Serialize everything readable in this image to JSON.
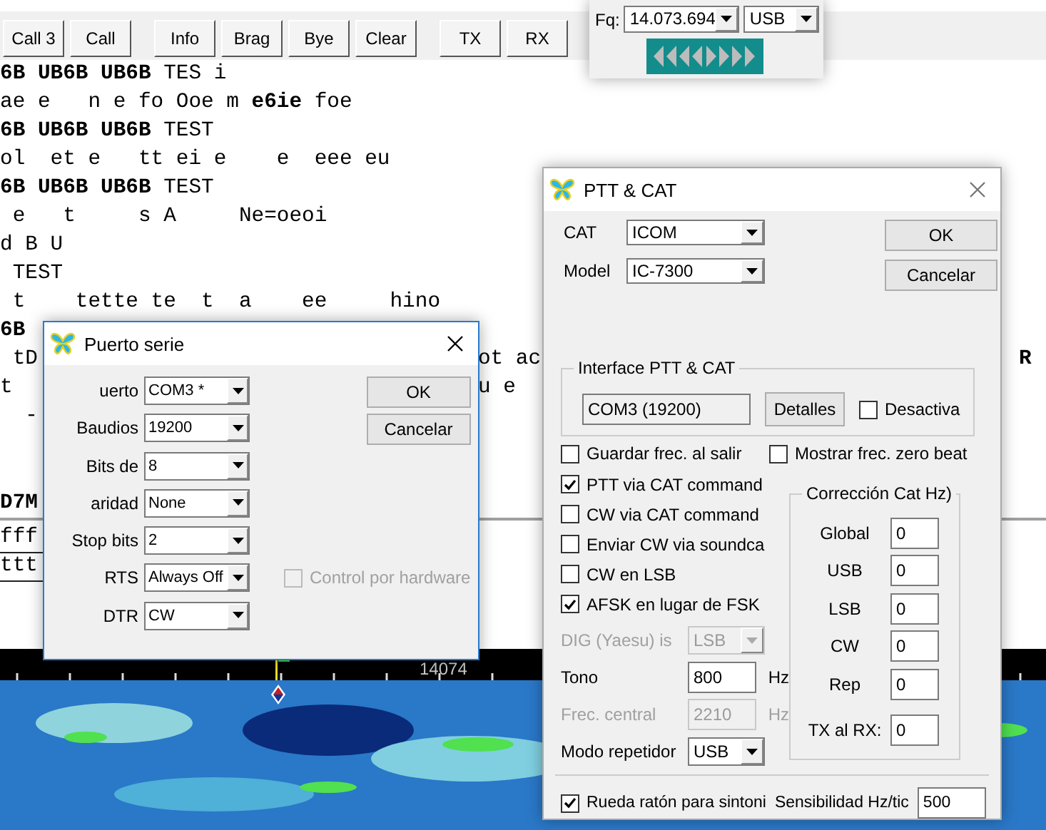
{
  "toolbar": [
    [
      "Call 3",
      "Call"
    ],
    [
      "Info",
      "Brag",
      "Bye",
      "Clear"
    ],
    [
      "TX",
      "RX"
    ]
  ],
  "receive_text": [
    [
      "**6B UB6B UB6B** TES i"
    ],
    [
      "ae e   n e fo Ooe m **e6ie** foe"
    ],
    [
      "**6B UB6B UB6B** TEST"
    ],
    [
      "ol  et e   tt ei e    e  eee eu"
    ],
    [
      "**6B UB6B UB6B** TEST"
    ],
    [
      " e   t     s A     Ne=oeoi"
    ],
    [
      "d B U"
    ],
    [
      " TEST"
    ],
    [
      " t    tette te  t  a    ee     hino"
    ],
    [
      "**6B**"
    ],
    [
      " tD",
      "                                   ot ac",
      "                                      **R**"
    ],
    [
      "t",
      "                                     u e"
    ],
    [
      "  -"
    ],
    [
      "**D7M**"
    ]
  ],
  "transmit_text": [
    "fff",
    "ttt"
  ],
  "waterfall": {
    "scale_label": "14074"
  },
  "frequency_bar": {
    "label": "Fq:",
    "frequency": "14.073.694",
    "mode": "USB"
  },
  "serial_dialog": {
    "title": "Puerto serie",
    "fields": [
      {
        "label": "uerto",
        "value": "COM3 *"
      },
      {
        "label": "Baudios",
        "value": "19200"
      },
      {
        "label": "Bits de",
        "value": "8"
      },
      {
        "label": "aridad",
        "value": "None"
      },
      {
        "label": "Stop bits",
        "value": "2"
      },
      {
        "label": "RTS",
        "value": "Always Off"
      },
      {
        "label": "DTR",
        "value": "CW"
      }
    ],
    "hardware_control": {
      "label": "Control por hardware",
      "checked": false,
      "disabled": true
    },
    "buttons": [
      "OK",
      "Cancelar"
    ]
  },
  "ptt_cat_dialog": {
    "title": "PTT & CAT",
    "selectors": [
      {
        "label": "CAT",
        "value": "ICOM"
      },
      {
        "label": "Model",
        "value": "IC-7300"
      }
    ],
    "buttons": [
      "OK",
      "Cancelar"
    ],
    "interface": {
      "title": "Interface PTT & CAT",
      "port": "COM3 (19200)",
      "details_button": "Detalles",
      "disable": {
        "label": "Desactiva",
        "checked": false
      }
    },
    "save_freq": {
      "label": "Guardar frec. al salir",
      "checked": false
    },
    "zero_beat": {
      "label": "Mostrar frec. zero beat",
      "checked": false
    },
    "options": [
      {
        "label": "PTT via CAT command",
        "checked": true
      },
      {
        "label": "CW via CAT command",
        "checked": false
      },
      {
        "label": "Enviar CW via soundca",
        "checked": false
      },
      {
        "label": "CW en LSB",
        "checked": false
      },
      {
        "label": "AFSK en lugar de FSK",
        "checked": true
      }
    ],
    "settings": [
      {
        "kind": "dropdown",
        "label": "DIG (Yaesu) is",
        "value": "LSB",
        "disabled": true
      },
      {
        "kind": "field",
        "label": "Tono",
        "value": "800",
        "unit": "Hz",
        "disabled": false
      },
      {
        "kind": "field",
        "label": "Frec. central",
        "value": "2210",
        "unit": "Hz",
        "disabled": true
      },
      {
        "kind": "dropdown",
        "label": "Modo repetidor",
        "value": "USB",
        "disabled": false
      }
    ],
    "correction": {
      "title": "Corrección Cat Hz)",
      "rows": [
        {
          "label": "Global",
          "value": "0"
        },
        {
          "label": "USB",
          "value": "0"
        },
        {
          "label": "LSB",
          "value": "0"
        },
        {
          "label": "CW",
          "value": "0"
        },
        {
          "label": "Rep",
          "value": "0"
        },
        {
          "label": "TX al RX:",
          "value": "0"
        }
      ]
    },
    "mouse_wheel": {
      "label": "Rueda ratón para sintoni",
      "checked": true
    },
    "sensitivity": {
      "label": "Sensibilidad Hz/tic",
      "value": "500"
    }
  }
}
